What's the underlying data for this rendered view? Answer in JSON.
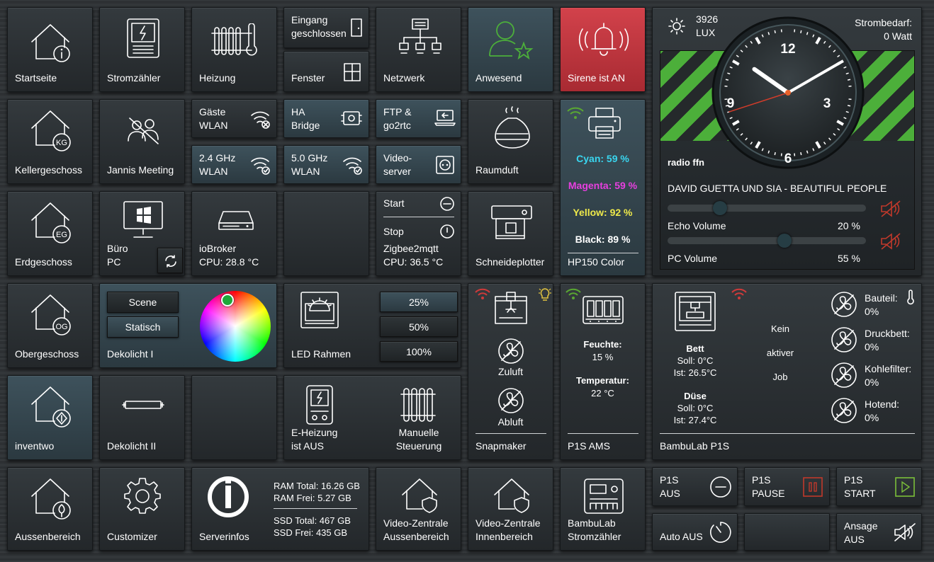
{
  "tiles": {
    "startseite": "Startseite",
    "stromzaehler": "Stromzähler",
    "heizung": "Heizung",
    "eingang": "Eingang\ngeschlossen",
    "fenster": "Fenster",
    "netzwerk": "Netzwerk",
    "anwesend": "Anwesend",
    "sirene": "Sirene ist AN",
    "keller": "Kellergeschoss",
    "jannis": "Jannis Meeting",
    "gaeste_wlan": "Gäste\nWLAN",
    "ha_bridge": "HA\nBridge",
    "ftp": "FTP &\ngo2rtc",
    "raumduft": "Raumduft",
    "wlan24": "2.4 GHz\nWLAN",
    "wlan50": "5.0 GHz\nWLAN",
    "videoserver": "Video-\nserver",
    "erdgeschoss": "Erdgeschoss",
    "buero": "Büro\nPC",
    "iobroker": "ioBroker\nCPU: 28.8 °C",
    "zigbee_start": "Start",
    "zigbee_stop": "Stop",
    "zigbee": "Zigbee2mqtt\nCPU: 36.5 °C",
    "schneideplotter": "Schneideplotter",
    "obergeschoss": "Obergeschoss",
    "dekolicht1": "Dekolicht I",
    "scene_btn": "Scene",
    "statisch_btn": "Statisch",
    "led_rahmen": "LED Rahmen",
    "pct25": "25%",
    "pct50": "50%",
    "pct100": "100%",
    "inventwo": "inventwo",
    "dekolicht2": "Dekolicht II",
    "eheizung": "E-Heizung\nist AUS",
    "manuell": "Manuelle\nSteuerung",
    "aussenbereich": "Aussenbereich",
    "customizer": "Customizer",
    "serverinfos": "Serverinfos",
    "ram_total": "RAM Total: 16.26 GB",
    "ram_frei": "RAM Frei: 5.27 GB",
    "ssd_total": "SSD Total: 467 GB",
    "ssd_frei": "SSD Frei: 435 GB",
    "vz_aussen": "Video-Zentrale\nAussenbereich",
    "vz_innen": "Video-Zentrale\nInnenbereich",
    "bambu_strom": "BambuLab\nStromzähler",
    "p1s_aus": "P1S\nAUS",
    "p1s_pause": "P1S\nPAUSE",
    "p1s_start": "P1S\nSTART",
    "auto_aus": "Auto AUS",
    "ansage": "Ansage\nAUS"
  },
  "floor_badges": {
    "keller": "KG",
    "erd": "EG",
    "ober": "OG"
  },
  "printer": {
    "cyan": "Cyan: 59 %",
    "magenta": "Magenta: 59 %",
    "yellow": "Yellow: 92 %",
    "black": "Black: 89 %",
    "name": "HP150 Color",
    "colors": {
      "cyan": "#39d6f0",
      "magenta": "#e83fe0",
      "yellow": "#eee94a",
      "black": "#ffffff"
    }
  },
  "snapmaker": {
    "zuluft": "Zuluft",
    "abluft": "Abluft",
    "name": "Snapmaker"
  },
  "ams": {
    "feuchte_label": "Feuchte:",
    "feuchte": "15 %",
    "temp_label": "Temperatur:",
    "temp": "22 °C",
    "name": "P1S AMS"
  },
  "bambu": {
    "bett": "Bett",
    "bett_soll": "Soll: 0°C",
    "bett_ist": "Ist: 26.5°C",
    "duese": "Düse",
    "duese_soll": "Soll: 0°C",
    "duese_ist": "Ist: 27.4°C",
    "job1": "Kein",
    "job2": "aktiver",
    "job3": "Job",
    "fans": [
      {
        "name": "Bauteil:",
        "value": "0%"
      },
      {
        "name": "Druckbett:",
        "value": "0%"
      },
      {
        "name": "Kohlefilter:",
        "value": "0%"
      },
      {
        "name": "Hotend:",
        "value": "0%"
      }
    ],
    "name": "BambuLab P1S"
  },
  "weather": {
    "lux": "3926",
    "lux_unit": "LUX",
    "strom_label": "Strombedarf:",
    "strom_value": "0 Watt"
  },
  "clock": {
    "hour": 10,
    "minute": 10,
    "second": 42,
    "n12": "12",
    "n3": "3",
    "n6": "6",
    "n9": "9"
  },
  "radio": {
    "station": "radio ffn",
    "track": "DAVID GUETTA UND SIA - BEAUTIFUL PEOPLE",
    "echo_label": "Echo Volume",
    "echo_value": "20 %",
    "echo_level": 0.2,
    "pc_label": "PC Volume",
    "pc_value": "55 %",
    "pc_level": 0.55
  },
  "colors": {
    "accent_green": "#4caf3a",
    "wifi_red": "#d03a3a",
    "wifi_green": "#5aa832",
    "mute_red": "#c0392b",
    "play_green": "#7bbf3a",
    "sirene_red": "#c9343d"
  }
}
